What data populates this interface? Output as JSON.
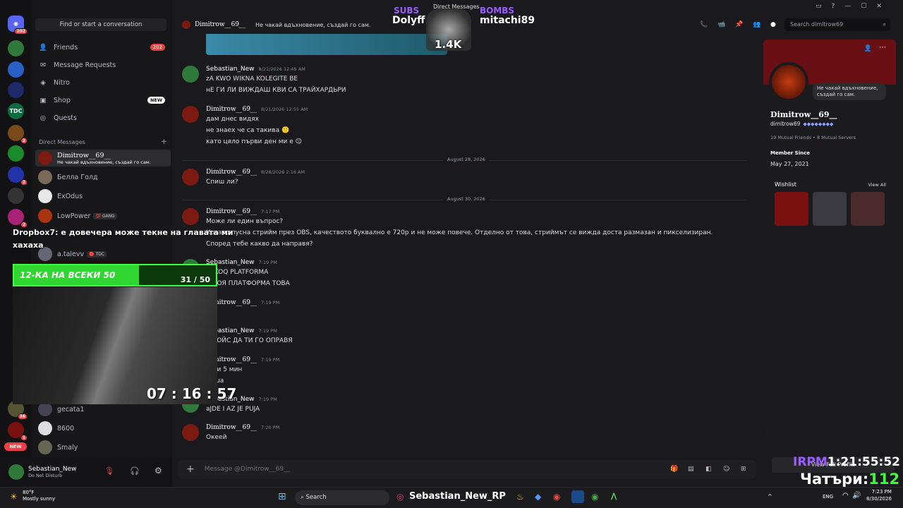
{
  "window": {
    "title": "Direct Messages"
  },
  "rail": {
    "discord_badge": "202",
    "servers": [
      "",
      "",
      "",
      "TDC",
      "",
      "",
      "",
      "",
      ""
    ],
    "server_badges": [
      "",
      "",
      "",
      "",
      "2",
      "",
      "2",
      "",
      "2"
    ],
    "bottom_badges": [
      "36",
      "1"
    ],
    "new_label": "NEW"
  },
  "sidebar": {
    "search_label": "Find or start a conversation",
    "nav": [
      {
        "label": "Friends",
        "icon": "friends-icon",
        "count": "202"
      },
      {
        "label": "Message Requests",
        "icon": "mail-icon"
      },
      {
        "label": "Nitro",
        "icon": "nitro-icon"
      },
      {
        "label": "Shop",
        "icon": "shop-icon",
        "badge": "NEW"
      },
      {
        "label": "Quests",
        "icon": "quests-icon"
      }
    ],
    "dm_header": "Direct Messages",
    "dms": [
      {
        "name": "Dimitrow__69__",
        "status": "Не чакай вдъхновение, създай го сам.",
        "color": "#7a1a10"
      },
      {
        "name": "Белла Голд",
        "color": "#7a6a5a"
      },
      {
        "name": "ExOdus",
        "color": "#e8e8e8"
      },
      {
        "name": "LowPower",
        "tag": "💯 GANG",
        "color": "#aa3311"
      },
      {
        "name": "a.talevv",
        "tag": "🔴 TDC",
        "color": "#667"
      },
      {
        "name": "gecata1",
        "color": "#445"
      },
      {
        "name": "8600",
        "color": "#ddd"
      },
      {
        "name": "Smaly",
        "color": "#665"
      }
    ]
  },
  "user": {
    "name": "Sebastian_New",
    "status": "Do Not Disturb"
  },
  "chat": {
    "header_name": "Dimitrow__69__",
    "header_status": "Не чакай вдъхновение, създай го сам.",
    "search_placeholder": "Search dimitrow69",
    "composer_placeholder": "Message @Dimitrow__69__",
    "dividers": [
      "August 28, 2026",
      "August 30, 2026"
    ],
    "messages": [
      {
        "author": "Sebastian_New",
        "time": "8/21/2026 12:45 AM",
        "lines": [
          "zA KWO WIKNA KOLEGITE BE",
          "нЕ ГИ ЛИ ВИЖДАШ КВИ СА ТРАЙХАРДЬРИ"
        ]
      },
      {
        "author": "Dimitrow__69__",
        "time": "8/21/2026 12:55 AM",
        "lines": [
          "дам днес видях",
          "не знаех че са такива 🙂",
          "като цяло първи ден ми е 😑"
        ]
      },
      {
        "author": "Dimitrow__69__",
        "time": "8/28/2026 2:16 AM",
        "lines": [
          "Спиш ли?"
        ]
      },
      {
        "author": "Dimitrow__69__",
        "time": "7:17 PM",
        "lines": [
          "Може ли един въпрос?",
          "Когато пусна стрийм през OBS, качеството буквално е 720p и не може повече. Отделно от това, стриймът се вижда доста размазан и пикселизиран.",
          "Според тебе какво да направя?"
        ]
      },
      {
        "author": "Sebastian_New",
        "time": "7:19 PM",
        "lines": [
          "W KOQ PLATFORMA",
          "В КОЯ ПЛАТФОРМА ТОВА"
        ]
      },
      {
        "author": "Dimitrow__69__",
        "time": "7:19 PM",
        "lines": []
      },
      {
        "author": "Sebastian_New",
        "time": "7:19 PM",
        "lines": [
          "А ВОЙС ДА ТИ ГО ОПРАВЯ"
        ]
      },
      {
        "author": "Dimitrow__69__",
        "time": "7:19 PM",
        "lines": [
          "и ми 5 мин",
          "душа"
        ]
      },
      {
        "author": "Sebastian_New",
        "time": "7:19 PM",
        "lines": [
          "aJDE I AZ JE PUJA"
        ]
      },
      {
        "author": "Dimitrow__69__",
        "time": "7:20 PM",
        "lines": [
          "Океей"
        ]
      }
    ]
  },
  "profile": {
    "name": "Dimitrow__69__",
    "username": "dimitrow69",
    "status": "Не чакай вдъхновение, създай го сам.",
    "mutual_friends": "19 Mutual Friends",
    "mutual_servers": "8 Mutual Servers",
    "member_since_label": "Member Since",
    "member_since": "May 27, 2021",
    "wishlist_label": "Wishlist",
    "view_all": "View All",
    "view_full": "View Full Profile"
  },
  "overlay": {
    "subs_label": "SUBS",
    "subs_name": "Dolyff",
    "bombs_label": "BOMBS",
    "bombs_name": "mitachi89",
    "bombs_count": "1.4K",
    "chat_user": "Dropbox7",
    "chat_text": ": е довечера може текне на главата ми",
    "chat_text2": "хахаха",
    "goal_label": "12-КА НА ВСЕКИ 50",
    "goal_progress": "31 / 50",
    "goal_fraction": 0.62,
    "timer": "07 : 16 : 57",
    "irpm_label": "IRPM",
    "irpm_time": "1:21:55:52",
    "chat_count_label": "Чатъри:",
    "chat_count": "112"
  },
  "taskbar": {
    "weather_temp": "80°F",
    "weather_text": "Mostly sunny",
    "search": "Search",
    "streamer": "Sebastian_New_RP",
    "lang": "ENG",
    "time": "7:23 PM",
    "date": "8/30/2026"
  }
}
